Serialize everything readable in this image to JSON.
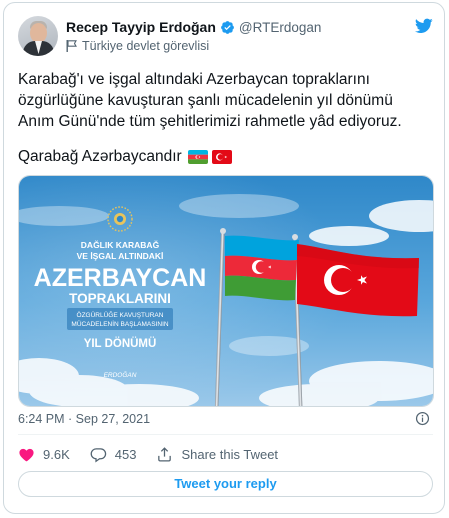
{
  "author": {
    "display_name": "Recep Tayyip Erdoğan",
    "handle": "@RTErdogan",
    "label": "Türkiye devlet görevlisi"
  },
  "tweet": {
    "line1": "Karabağ'ı ve işgal altındaki Azerbaycan topraklarını",
    "line2": "özgürlüğüne kavuşturan şanlı mücadelenin yıl dönümü",
    "line3": "Anım Günü'nde tüm şehitlerimizi rahmetle yâd ediyoruz.",
    "line4": "Qarabağ Azərbaycandır"
  },
  "media": {
    "kicker1": "DAĞLIK KARABAĞ",
    "kicker2": "VE İŞGAL ALTINDAKİ",
    "headline": "AZERBAYCAN",
    "subhead": "TOPRAKLARINI",
    "banner1": "ÖZGÜRLÜĞE KAVUŞTURAN",
    "banner2": "MÜCADELENİN BAŞLAMASININ",
    "footer": "YIL DÖNÜMÜ",
    "signature": "ERDOĞAN"
  },
  "meta": {
    "timestamp": "6:24 PM · Sep 27, 2021"
  },
  "actions": {
    "likes": "9.6K",
    "replies": "453",
    "share": "Share this Tweet"
  },
  "reply_button": "Tweet your reply",
  "colors": {
    "accent": "#1d9bf0",
    "like_red": "#f91880",
    "text_secondary": "#536471"
  },
  "icons": [
    "verified-badge-icon",
    "government-flag-icon",
    "twitter-bird-icon",
    "info-icon",
    "heart-icon",
    "reply-bubble-icon",
    "share-upload-icon"
  ]
}
